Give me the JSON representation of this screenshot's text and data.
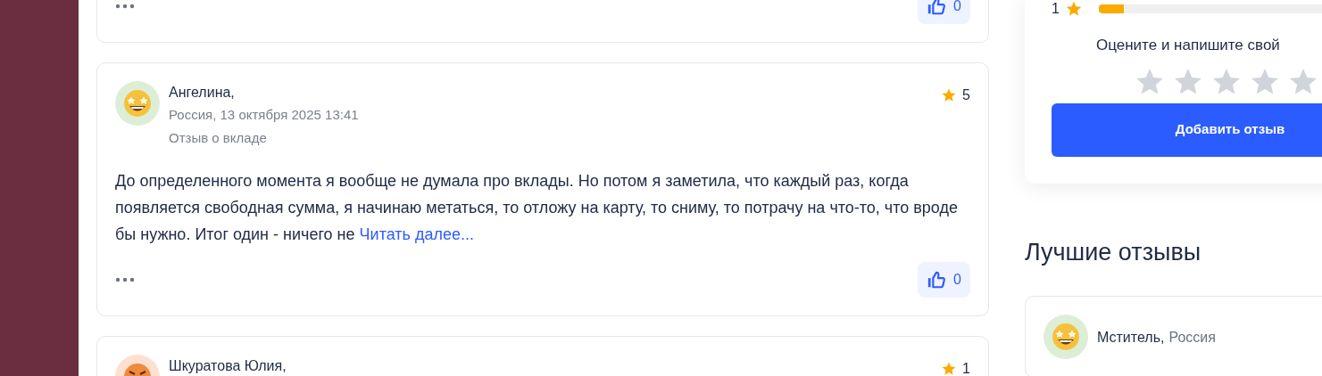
{
  "reviews": [
    {
      "kind": "footer_only",
      "likes": "0"
    },
    {
      "kind": "full",
      "avatar": {
        "kind": "starstruck"
      },
      "author": "Ангелина,",
      "meta": "Россия, 13 октября 2025 13:41",
      "subject": "Отзыв о вкладе",
      "rating": "5",
      "text": "До определенного момента я вообще не думала про вклады. Но потом я заметила, что каждый раз, когда появляется свободная сумма, я начинаю метаться, то отложу на карту, то сниму, то потрачу на что-то, что вроде бы нужно. Итог один - ничего не",
      "read_more": "Читать далее...",
      "likes": "0"
    },
    {
      "kind": "header_only",
      "avatar": {
        "kind": "angry"
      },
      "author": "Шкуратова Юлия,",
      "rating": "1"
    }
  ],
  "rating_panel": {
    "row": {
      "label": "1",
      "level": 0.08
    },
    "prompt": "Оцените и напишите свой",
    "stars": 0,
    "button": "Добавить отзыв"
  },
  "best_reviews": {
    "title": "Лучшие отзывы",
    "items": [
      {
        "avatar": {
          "kind": "starstruck"
        },
        "author": "Мститель,",
        "country": "Россия"
      }
    ]
  }
}
